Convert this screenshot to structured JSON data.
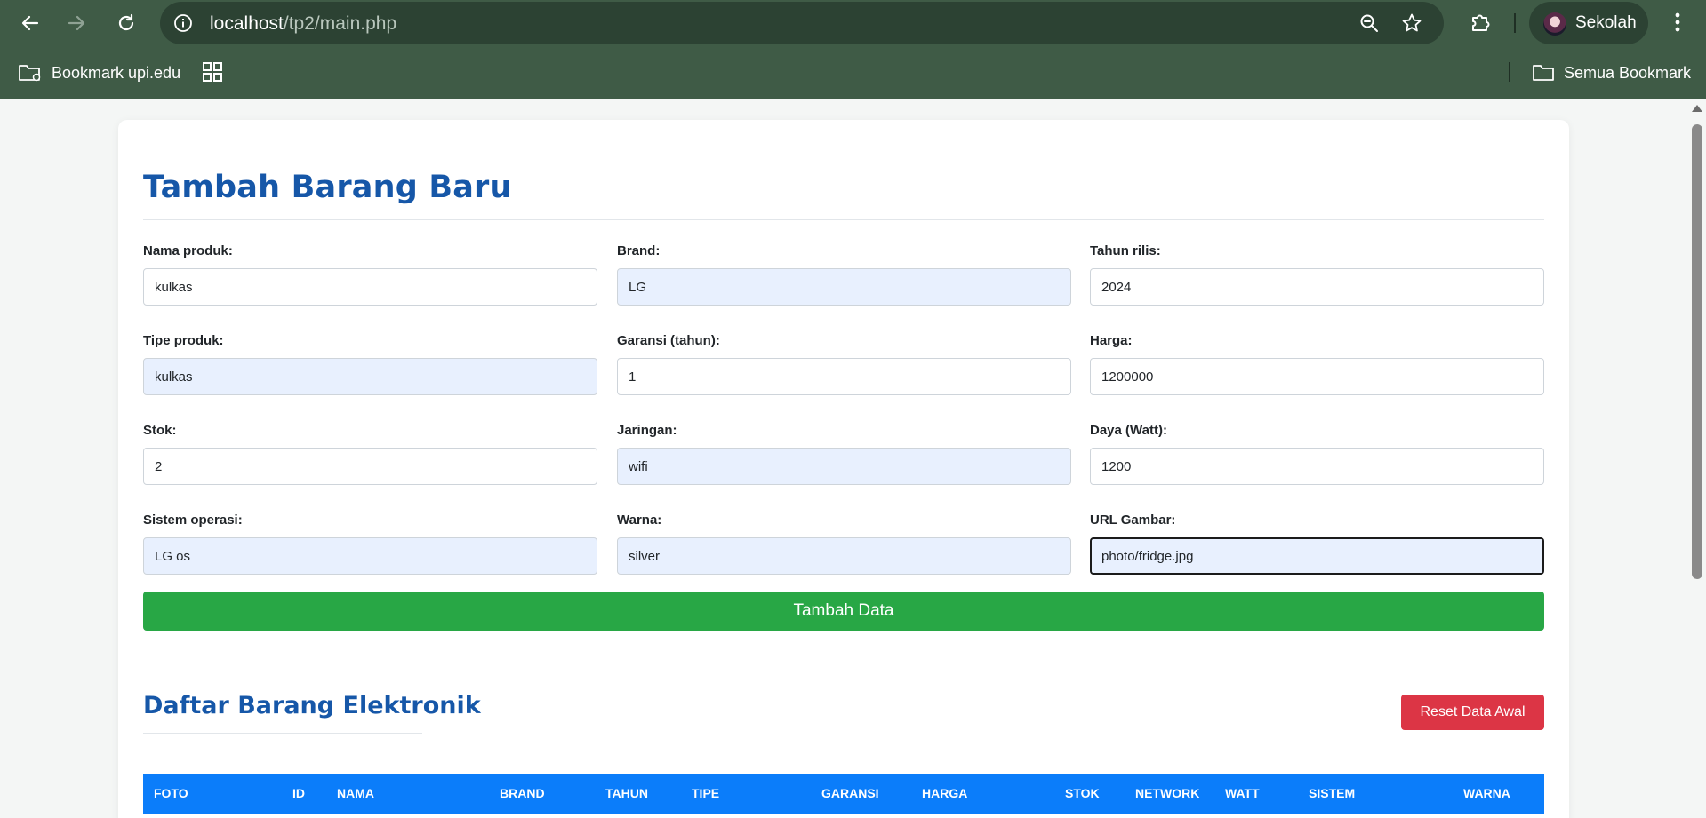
{
  "browser": {
    "url_host": "localhost",
    "url_path": "/tp2/main.php",
    "profile_name": "Sekolah",
    "bookmarks": {
      "folder_label": "Bookmark upi.edu",
      "all_label": "Semua Bookmark"
    }
  },
  "form": {
    "title": "Tambah Barang Baru",
    "fields": [
      {
        "label": "Nama produk:",
        "value": "kulkas"
      },
      {
        "label": "Brand:",
        "value": "LG"
      },
      {
        "label": "Tahun rilis:",
        "value": "2024"
      },
      {
        "label": "Tipe produk:",
        "value": "kulkas"
      },
      {
        "label": "Garansi (tahun):",
        "value": "1"
      },
      {
        "label": "Harga:",
        "value": "1200000"
      },
      {
        "label": "Stok:",
        "value": "2"
      },
      {
        "label": "Jaringan:",
        "value": "wifi"
      },
      {
        "label": "Daya (Watt):",
        "value": "1200"
      },
      {
        "label": "Sistem operasi:",
        "value": "LG os"
      },
      {
        "label": "Warna:",
        "value": "silver"
      },
      {
        "label": "URL Gambar:",
        "value": "photo/fridge.jpg"
      }
    ],
    "submit_label": "Tambah Data"
  },
  "list": {
    "title": "Daftar Barang Elektronik",
    "reset_label": "Reset Data Awal",
    "columns": [
      "FOTO",
      "ID",
      "NAMA",
      "BRAND",
      "TAHUN",
      "TIPE",
      "GARANSI",
      "HARGA",
      "STOK",
      "NETWORK",
      "WATT",
      "SISTEM",
      "WARNA"
    ]
  },
  "colors": {
    "chrome": "#3f5b46",
    "heading": "#1657a8",
    "submit": "#28a745",
    "reset": "#dc3545",
    "table_header": "#0b7dfa"
  }
}
